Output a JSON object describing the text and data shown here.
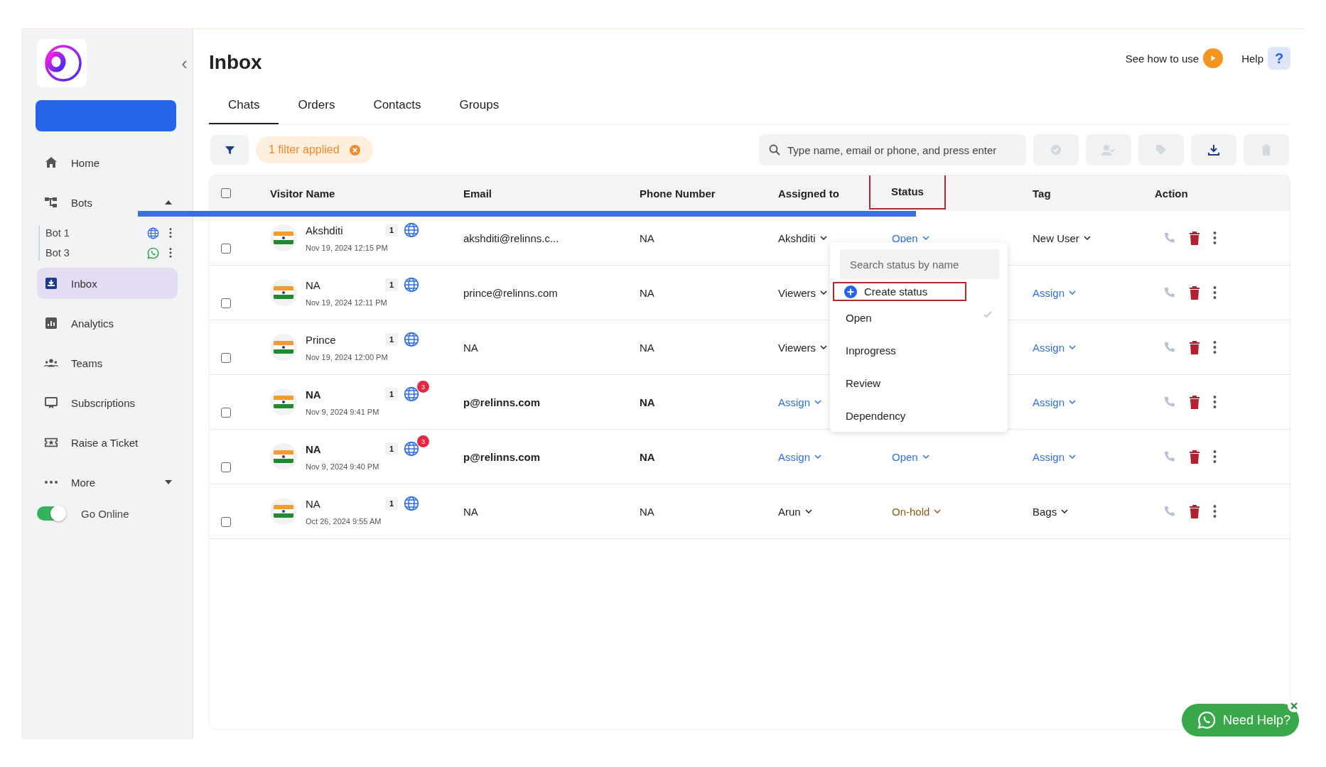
{
  "sidebar": {
    "collapse_icon": "‹",
    "nav": [
      {
        "kind": "link",
        "label": "Home",
        "selected": false
      },
      {
        "kind": "group",
        "label": "Bots",
        "expanded": true,
        "children": [
          {
            "label": "Bot 1",
            "kind": "web"
          },
          {
            "label": "Bot 3",
            "kind": "whatsapp"
          }
        ]
      },
      {
        "kind": "link",
        "label": "Inbox",
        "selected": true
      },
      {
        "kind": "link",
        "label": "Analytics",
        "selected": false
      },
      {
        "kind": "link",
        "label": "Teams",
        "selected": false
      },
      {
        "kind": "link",
        "label": "Subscriptions",
        "selected": false
      },
      {
        "kind": "link",
        "label": "Raise a Ticket",
        "selected": false
      },
      {
        "kind": "more",
        "label": "More",
        "expanded": false
      }
    ],
    "toggle": {
      "label": "Go Online",
      "on": true
    }
  },
  "header": {
    "title": "Inbox",
    "guide": "See how to use",
    "help": "Help",
    "help_icon": "?"
  },
  "tabs": [
    {
      "label": "Chats",
      "selected": true
    },
    {
      "label": "Orders",
      "selected": false
    },
    {
      "label": "Contacts",
      "selected": false
    },
    {
      "label": "Groups",
      "selected": false
    }
  ],
  "toolbar": {
    "filter_chip": "1 filter applied",
    "search": {
      "placeholder": "Type name, email or phone, and press enter"
    },
    "actions": [
      {
        "kind": "resolve",
        "disabled": true
      },
      {
        "kind": "assign",
        "disabled": true
      },
      {
        "kind": "tag",
        "disabled": true
      },
      {
        "kind": "download",
        "disabled": false
      },
      {
        "kind": "delete",
        "disabled": true
      }
    ]
  },
  "table": {
    "select_all": {
      "checked": false
    },
    "columns": [
      "Visitor Name",
      "Email",
      "Phone Number",
      "Assigned to",
      "Status",
      "Tag",
      "Action"
    ],
    "rows": [
      {
        "checked": false,
        "name": "Akshditi",
        "time": "Nov 19, 2024 12:15 PM",
        "count": "1",
        "unread": null,
        "email": "akshditi@relinns.c...",
        "phone": "NA",
        "assigned": {
          "text": "Akshditi",
          "kind": "user"
        },
        "status": {
          "text": "Open",
          "color": "#2f6fe0"
        },
        "tag": {
          "text": "New User",
          "kind": "user"
        },
        "bold": false
      },
      {
        "checked": false,
        "name": "NA",
        "time": "Nov 19, 2024 12:11 PM",
        "count": "1",
        "unread": null,
        "email": "prince@relinns.com",
        "phone": "NA",
        "assigned": {
          "text": "Viewers",
          "kind": "user"
        },
        "status": null,
        "tag": {
          "text": "Assign",
          "kind": "assign"
        },
        "bold": false
      },
      {
        "checked": false,
        "name": "Prince",
        "time": "Nov 19, 2024 12:00 PM",
        "count": "1",
        "unread": null,
        "email": "NA",
        "phone": "NA",
        "assigned": {
          "text": "Viewers",
          "kind": "user"
        },
        "status": null,
        "tag": {
          "text": "Assign",
          "kind": "assign"
        },
        "bold": false
      },
      {
        "checked": false,
        "name": "NA",
        "time": "Nov 9, 2024 9:41 PM",
        "count": "1",
        "unread": "3",
        "email": "p@relinns.com",
        "phone": "NA",
        "assigned": {
          "text": "Assign",
          "kind": "assign"
        },
        "status": null,
        "tag": {
          "text": "Assign",
          "kind": "assign"
        },
        "bold": true
      },
      {
        "checked": false,
        "name": "NA",
        "time": "Nov 9, 2024 9:40 PM",
        "count": "1",
        "unread": "3",
        "email": "p@relinns.com",
        "phone": "NA",
        "assigned": {
          "text": "Assign",
          "kind": "assign"
        },
        "status": {
          "text": "Open",
          "color": "#2f6fe0"
        },
        "tag": {
          "text": "Assign",
          "kind": "assign"
        },
        "bold": true
      },
      {
        "checked": false,
        "name": "NA",
        "time": "Oct 26, 2024 9:55 AM",
        "count": "1",
        "unread": null,
        "email": "NA",
        "phone": "NA",
        "assigned": {
          "text": "Arun",
          "kind": "user"
        },
        "status": {
          "text": "On-hold",
          "color": "#8a5a12"
        },
        "tag": {
          "text": "Bags",
          "kind": "user"
        },
        "bold": false
      }
    ]
  },
  "status_menu": {
    "search": {
      "placeholder": "Search status by name"
    },
    "create": "Create status",
    "options": [
      {
        "label": "Open",
        "selected": true
      },
      {
        "label": "Inprogress",
        "selected": false
      },
      {
        "label": "Review",
        "selected": false
      },
      {
        "label": "Dependency",
        "selected": false
      }
    ]
  },
  "help_widget": {
    "label": "Need Help?"
  }
}
